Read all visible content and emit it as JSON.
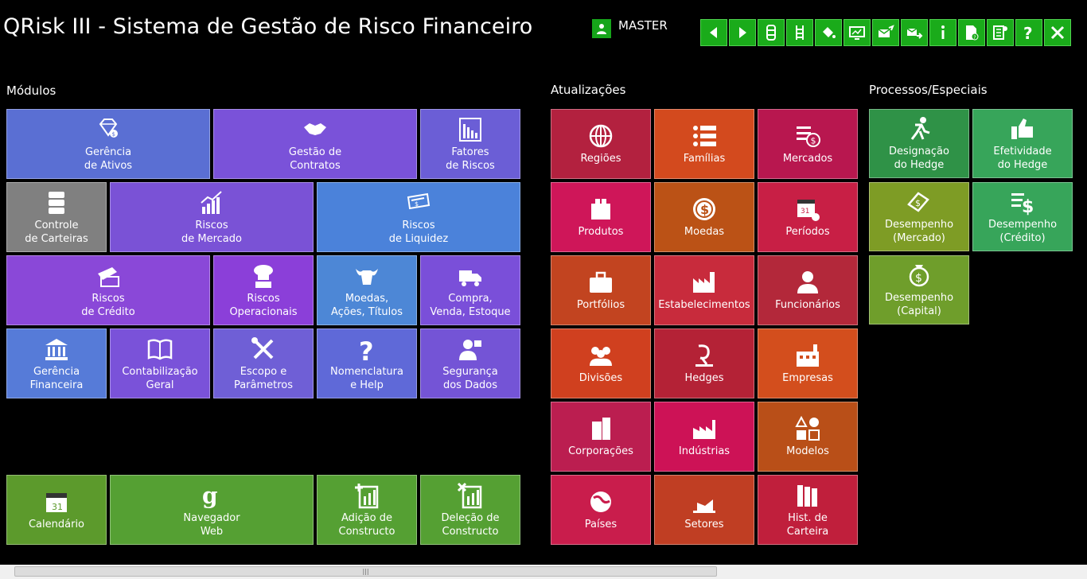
{
  "app": {
    "title": "QRisk III - Sistema de Gestão de Risco Financeiro"
  },
  "user": {
    "name": "MASTER"
  },
  "toolbar": [
    "back",
    "forward",
    "track-hor",
    "track-vert",
    "paint",
    "monitor",
    "mail-send",
    "mail-forward",
    "info",
    "doc-help",
    "calc-settings",
    "help",
    "close"
  ],
  "sections": {
    "modulos": "Módulos",
    "atualizacoes": "Atualizações",
    "processos": "Processos/Especiais"
  },
  "colors": {
    "green": "#1aab1a",
    "blue": "#5575d0",
    "purple": "#7a54d6",
    "gray": "#7a7a7a",
    "red": "#c4263f"
  },
  "tiles": [
    {
      "name": "tile-gerencia-ativos",
      "label": "Gerência\nde Ativos",
      "icon": "diamond",
      "bg": "#5a6fd3"
    },
    {
      "name": "tile-gestao-contratos",
      "label": "Gestão de\nContratos",
      "icon": "handshake",
      "bg": "#7a52d9"
    },
    {
      "name": "tile-fatores-riscos",
      "label": "Fatores\nde  Riscos",
      "icon": "barchart",
      "bg": "#6b5ed6"
    },
    {
      "name": "tile-controle-carteiras",
      "label": "Controle\nde Carteiras",
      "icon": "server",
      "bg": "#808080"
    },
    {
      "name": "tile-riscos-mercado",
      "label": "Riscos\nde  Mercado",
      "icon": "growth",
      "bg": "#7a52d6"
    },
    {
      "name": "tile-riscos-liquidez",
      "label": "Riscos\nde Liquidez",
      "icon": "cash",
      "bg": "#4b82da"
    },
    {
      "name": "tile-riscos-credito",
      "label": "Riscos\nde  Crédito",
      "icon": "cards",
      "bg": "#8a48d8"
    },
    {
      "name": "tile-riscos-operacionais",
      "label": "Riscos\nOperacionais",
      "icon": "chef",
      "bg": "#8b3fd9"
    },
    {
      "name": "tile-moedas-acoes",
      "label": "Moedas,\nAções, Títulos",
      "icon": "bull",
      "bg": "#4d87d6"
    },
    {
      "name": "tile-compra-venda",
      "label": "Compra,\nVenda, Estoque",
      "icon": "truck",
      "bg": "#7a4fd9"
    },
    {
      "name": "tile-gerencia-financeira",
      "label": "Gerência\nFinanceira",
      "icon": "bank",
      "bg": "#567bd8"
    },
    {
      "name": "tile-contabilizacao",
      "label": "Contabilização\nGeral",
      "icon": "book",
      "bg": "#7a52d9"
    },
    {
      "name": "tile-escopo-parametros",
      "label": "Escopo e\nParâmetros",
      "icon": "tools",
      "bg": "#6f5fd6"
    },
    {
      "name": "tile-nomenclatura",
      "label": "Nomenclatura\ne Help",
      "icon": "question",
      "bg": "#5f69d8"
    },
    {
      "name": "tile-seguranca",
      "label": "Segurança\ndos Dados",
      "icon": "userlock",
      "bg": "#7454d6"
    },
    {
      "name": "tile-calendario",
      "label": "Calendário",
      "icon": "calendar",
      "bg": "#5c9a2c"
    },
    {
      "name": "tile-navegador",
      "label": "Navegador\nWeb",
      "icon": "google",
      "bg": "#55a033"
    },
    {
      "name": "tile-adicao",
      "label": "Adição de\nConstructo",
      "icon": "addchart",
      "bg": "#55a033"
    },
    {
      "name": "tile-delecao",
      "label": "Deleção de\nConstructo",
      "icon": "delchart",
      "bg": "#55a033"
    },
    {
      "name": "tile-regioes",
      "label": "Regiões",
      "icon": "globe",
      "bg": "#b3213f"
    },
    {
      "name": "tile-familias",
      "label": "Famílias",
      "icon": "list",
      "bg": "#d34a1e"
    },
    {
      "name": "tile-mercados",
      "label": "Mercados",
      "icon": "moneylist",
      "bg": "#b8174f"
    },
    {
      "name": "tile-produtos",
      "label": "Produtos",
      "icon": "box",
      "bg": "#cf1659"
    },
    {
      "name": "tile-moedas",
      "label": "Moedas",
      "icon": "coin",
      "bg": "#bb5216"
    },
    {
      "name": "tile-periodos",
      "label": "Períodos",
      "icon": "calgear",
      "bg": "#c81f45"
    },
    {
      "name": "tile-portfolios",
      "label": "Portfólios",
      "icon": "briefcase",
      "bg": "#c24420"
    },
    {
      "name": "tile-estabelecimentos",
      "label": "Estabelecimentos",
      "icon": "factory",
      "bg": "#c82b3c"
    },
    {
      "name": "tile-funcionarios",
      "label": "Funcionários",
      "icon": "employee",
      "bg": "#b3283a"
    },
    {
      "name": "tile-divisoes",
      "label": "Divisões",
      "icon": "group",
      "bg": "#d0401f"
    },
    {
      "name": "tile-hedges",
      "label": "Hedges",
      "icon": "hedge",
      "bg": "#b42236"
    },
    {
      "name": "tile-empresas",
      "label": "Empresas",
      "icon": "company",
      "bg": "#d34e1d"
    },
    {
      "name": "tile-corporacoes",
      "label": "Corporações",
      "icon": "building",
      "bg": "#bb1e50"
    },
    {
      "name": "tile-industrias",
      "label": "Indústrias",
      "icon": "industry",
      "bg": "#cd1256"
    },
    {
      "name": "tile-modelos",
      "label": "Modelos",
      "icon": "shapes",
      "bg": "#b94f18"
    },
    {
      "name": "tile-paises",
      "label": "Países",
      "icon": "earth",
      "bg": "#c91d4c"
    },
    {
      "name": "tile-setores",
      "label": "Setores",
      "icon": "sectors",
      "bg": "#c03e23"
    },
    {
      "name": "tile-hist-carteira",
      "label": "Hist. de\nCarteira",
      "icon": "books",
      "bg": "#c01f3c"
    },
    {
      "name": "tile-designacao-hedge",
      "label": "Designação\ndo Hedge",
      "icon": "runner",
      "bg": "#2f9247"
    },
    {
      "name": "tile-efetividade-hedge",
      "label": "Efetividade\ndo Hedge",
      "icon": "thumbsup",
      "bg": "#37a55a"
    },
    {
      "name": "tile-desempenho-mercado",
      "label": "Desempenho\n(Mercado)",
      "icon": "dollarhand",
      "bg": "#7e9c25"
    },
    {
      "name": "tile-desempenho-credito",
      "label": "Desempenho\n(Crédito)",
      "icon": "dollarchart",
      "bg": "#37a55a"
    },
    {
      "name": "tile-desempenho-capital",
      "label": "Desempenho\n(Capital)",
      "icon": "moneybag",
      "bg": "#6f9e2b"
    }
  ]
}
